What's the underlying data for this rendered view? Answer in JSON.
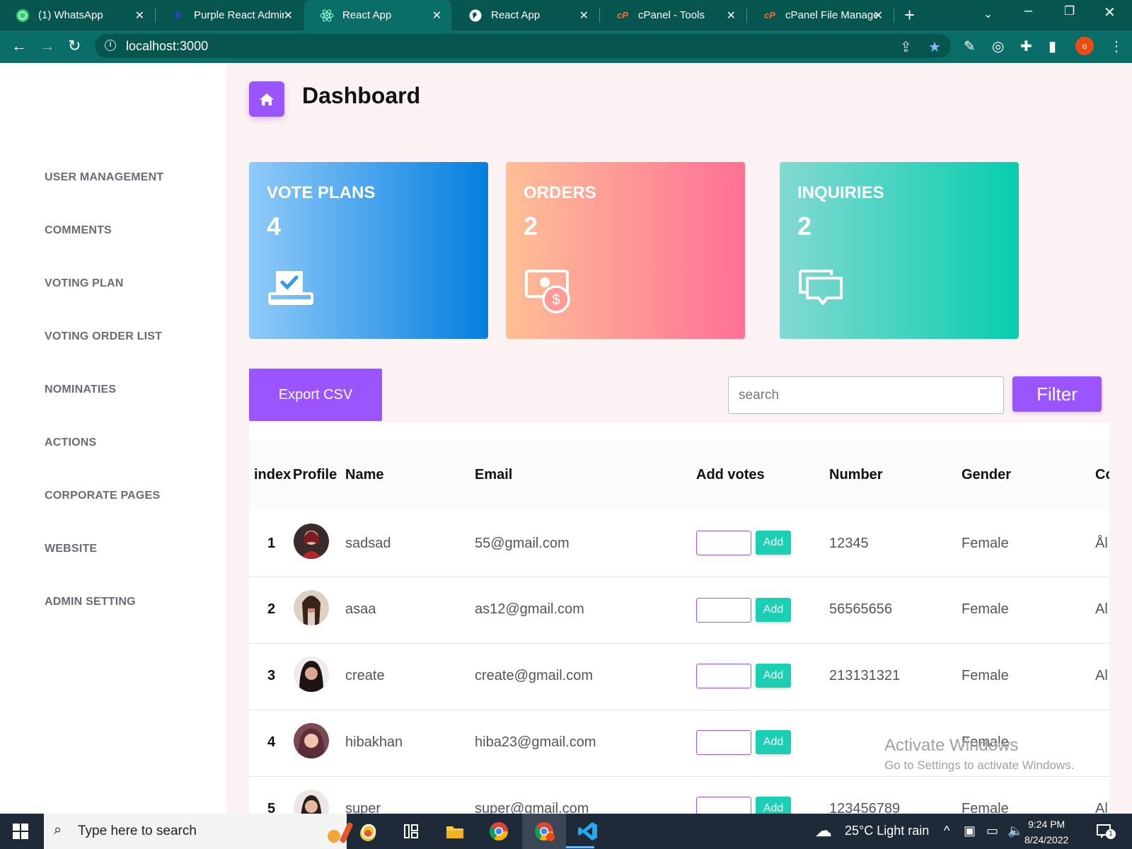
{
  "browser": {
    "tabs": [
      {
        "title": "(1) WhatsApp",
        "icon": "whatsapp-icon"
      },
      {
        "title": "Purple React Admin",
        "icon": "bootstrap-icon"
      },
      {
        "title": "React App",
        "icon": "react-icon",
        "active": true
      },
      {
        "title": "React App",
        "icon": "globe-icon"
      },
      {
        "title": "cPanel - Tools",
        "icon": "cpanel-icon"
      },
      {
        "title": "cPanel File Manage",
        "icon": "cpanel-icon"
      }
    ],
    "url": "localhost:3000",
    "profile_initial": "o"
  },
  "page": {
    "title": "Dashboard"
  },
  "sidebar": {
    "items": [
      {
        "label": "USER MANAGEMENT"
      },
      {
        "label": "COMMENTS"
      },
      {
        "label": "VOTING PLAN"
      },
      {
        "label": "VOTING ORDER LIST"
      },
      {
        "label": "NOMINATIES"
      },
      {
        "label": "ACTIONS"
      },
      {
        "label": "CORPORATE PAGES"
      },
      {
        "label": "WEBSITE"
      },
      {
        "label": "ADMIN SETTING"
      }
    ]
  },
  "cards": [
    {
      "label": "VOTE PLANS",
      "value": "4",
      "icon": "vote-box-icon",
      "colors": [
        "#90caf9",
        "#047edf"
      ]
    },
    {
      "label": "ORDERS",
      "value": "2",
      "icon": "money-dollar-icon",
      "colors": [
        "#ffbf96",
        "#fe7096"
      ]
    },
    {
      "label": "INQUIRIES",
      "value": "2",
      "icon": "chat-bubbles-icon",
      "colors": [
        "#84d9d2",
        "#07cdae"
      ]
    }
  ],
  "toolbar": {
    "export_label": "Export CSV",
    "search_placeholder": "search",
    "filter_label": "Filter"
  },
  "table": {
    "columns": [
      "index",
      "Profile",
      "Name",
      "Email",
      "Add votes",
      "Number",
      "Gender",
      "Co"
    ],
    "add_label": "Add",
    "rows": [
      {
        "index": "1",
        "name": "sadsad",
        "email": "55@gmail.com",
        "number": "12345",
        "gender": "Female",
        "extra": "Ål"
      },
      {
        "index": "2",
        "name": "asaa",
        "email": "as12@gmail.com",
        "number": "56565656",
        "gender": "Female",
        "extra": "Al"
      },
      {
        "index": "3",
        "name": "create",
        "email": "create@gmail.com",
        "number": "213131321",
        "gender": "Female",
        "extra": "Al"
      },
      {
        "index": "4",
        "name": "hibakhan",
        "email": "hiba23@gmail.com",
        "number": "",
        "gender": "Female",
        "extra": ""
      },
      {
        "index": "5",
        "name": "super",
        "email": "super@gmail.com",
        "number": "123456789",
        "gender": "Female",
        "extra": "Al"
      }
    ]
  },
  "watermark": {
    "line1": "Activate Windows",
    "line2": "Go to Settings to activate Windows."
  },
  "taskbar": {
    "search_placeholder": "Type here to search",
    "weather": "25°C  Light rain",
    "time": "9:24 PM",
    "date": "8/24/2022",
    "notification_count": "1"
  },
  "colors": {
    "accent": "#9a55ff",
    "add_button": "#1bcfb4",
    "browser_frame": "#06564f"
  }
}
